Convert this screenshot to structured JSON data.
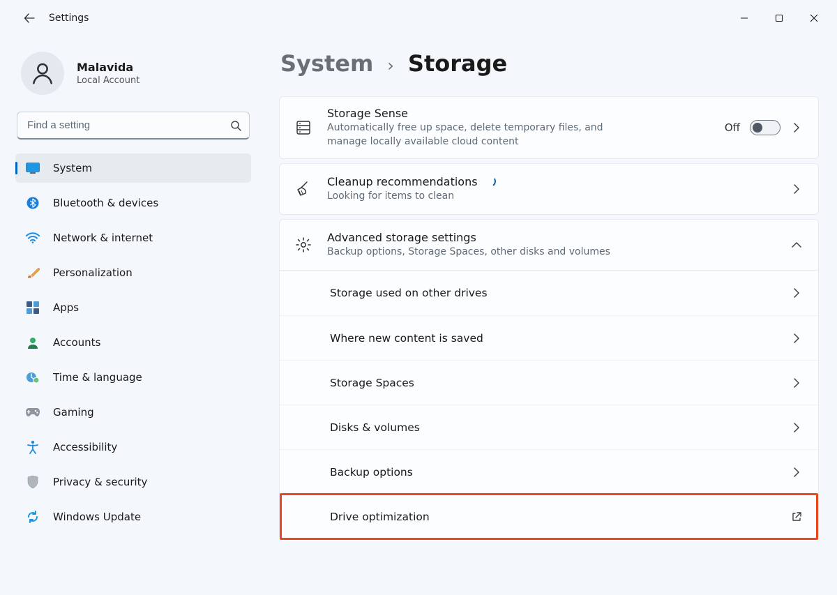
{
  "window": {
    "app_title": "Settings"
  },
  "account": {
    "name": "Malavida",
    "subtitle": "Local Account"
  },
  "search": {
    "placeholder": "Find a setting"
  },
  "nav": [
    {
      "id": "system",
      "label": "System",
      "selected": true
    },
    {
      "id": "bluetooth",
      "label": "Bluetooth & devices",
      "selected": false
    },
    {
      "id": "network",
      "label": "Network & internet",
      "selected": false
    },
    {
      "id": "personalization",
      "label": "Personalization",
      "selected": false
    },
    {
      "id": "apps",
      "label": "Apps",
      "selected": false
    },
    {
      "id": "accounts",
      "label": "Accounts",
      "selected": false
    },
    {
      "id": "time",
      "label": "Time & language",
      "selected": false
    },
    {
      "id": "gaming",
      "label": "Gaming",
      "selected": false
    },
    {
      "id": "accessibility",
      "label": "Accessibility",
      "selected": false
    },
    {
      "id": "privacy",
      "label": "Privacy & security",
      "selected": false
    },
    {
      "id": "update",
      "label": "Windows Update",
      "selected": false
    }
  ],
  "breadcrumb": {
    "parent": "System",
    "current": "Storage"
  },
  "storage_sense": {
    "title": "Storage Sense",
    "desc": "Automatically free up space, delete temporary files, and manage locally available cloud content",
    "toggle_label": "Off",
    "toggle_on": false
  },
  "cleanup": {
    "title": "Cleanup recommendations",
    "desc": "Looking for items to clean"
  },
  "advanced": {
    "title": "Advanced storage settings",
    "desc": "Backup options, Storage Spaces, other disks and volumes",
    "expanded": true,
    "items": [
      {
        "id": "other-drives",
        "label": "Storage used on other drives",
        "action": "chevron"
      },
      {
        "id": "new-content",
        "label": "Where new content is saved",
        "action": "chevron"
      },
      {
        "id": "storage-spaces",
        "label": "Storage Spaces",
        "action": "chevron"
      },
      {
        "id": "disks-volumes",
        "label": "Disks & volumes",
        "action": "chevron"
      },
      {
        "id": "backup",
        "label": "Backup options",
        "action": "chevron"
      },
      {
        "id": "drive-opt",
        "label": "Drive optimization",
        "action": "open-external",
        "highlight": true
      }
    ]
  }
}
